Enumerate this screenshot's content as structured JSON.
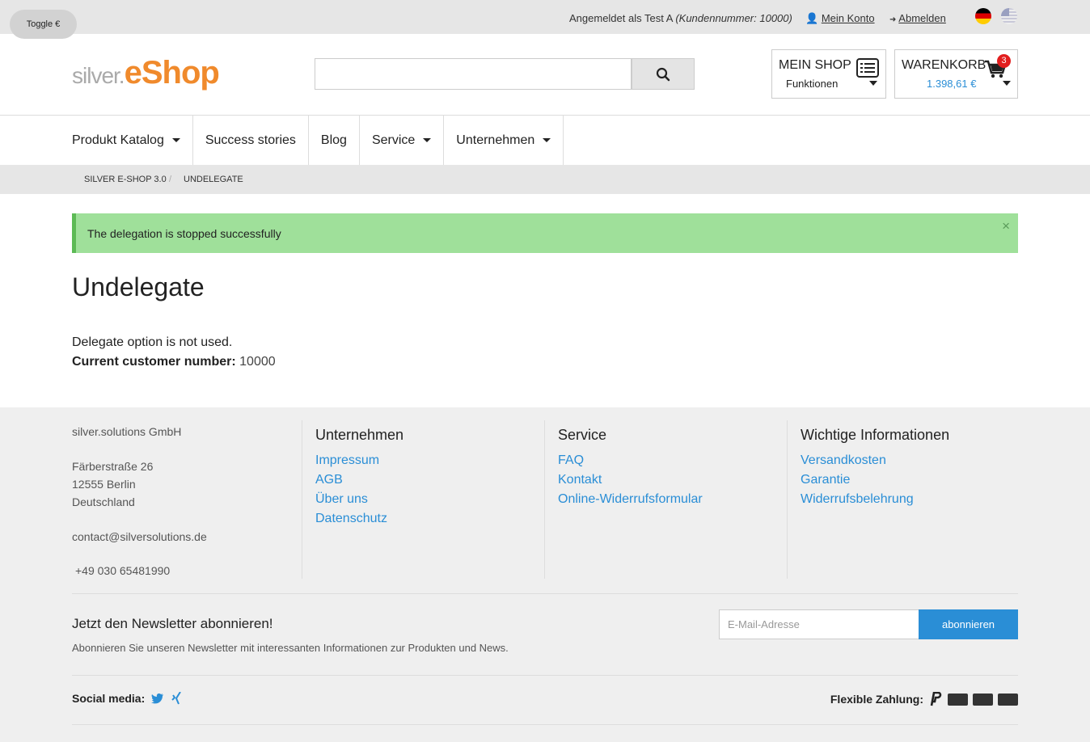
{
  "topbar": {
    "toggle_label": "Toggle €",
    "logged_in_prefix": "Angemeldet als Test A",
    "customer_number": "(Kundennummer: 10000)",
    "account_link": "Mein Konto",
    "logout_link": "Abmelden"
  },
  "logo": {
    "part1": "silver.",
    "part2": "eShop"
  },
  "search": {
    "placeholder": ""
  },
  "meinshop": {
    "title": "MEIN SHOP",
    "subtitle": "Funktionen"
  },
  "cart": {
    "title": "WARENKORB",
    "amount": "1.398,61 €",
    "count": "3"
  },
  "nav": {
    "items": [
      {
        "label": "Produkt Katalog",
        "dropdown": true
      },
      {
        "label": "Success stories",
        "dropdown": false
      },
      {
        "label": "Blog",
        "dropdown": false
      },
      {
        "label": "Service",
        "dropdown": true
      },
      {
        "label": "Unternehmen",
        "dropdown": true
      }
    ]
  },
  "breadcrumb": {
    "home": "SILVER E-SHOP 3.0",
    "separator": "/",
    "current": "UNDELEGATE"
  },
  "alert": {
    "message": "The delegation is stopped successfully",
    "close": "×"
  },
  "main": {
    "title": "Undelegate",
    "delegate_text": "Delegate option is not used.",
    "customer_label": "Current customer number:",
    "customer_value": "10000"
  },
  "footer": {
    "company": "silver.solutions GmbH",
    "street": "Färberstraße 26",
    "city": "12555 Berlin",
    "country": "Deutschland",
    "email": "contact@silversolutions.de",
    "phone": "+49 030 65481990",
    "columns": [
      {
        "heading": "Unternehmen",
        "links": [
          "Impressum",
          "AGB",
          "Über uns",
          "Datenschutz"
        ]
      },
      {
        "heading": "Service",
        "links": [
          "FAQ",
          "Kontakt",
          "Online-Widerrufsformular"
        ]
      },
      {
        "heading": "Wichtige Informationen",
        "links": [
          "Versandkosten",
          "Garantie",
          "Widerrufsbelehrung"
        ]
      }
    ],
    "newsletter_title": "Jetzt den Newsletter abonnieren!",
    "newsletter_text": "Abonnieren Sie unseren Newsletter mit interessanten Informationen zur Produkten und News.",
    "newsletter_placeholder": "E-Mail-Adresse",
    "newsletter_button": "abonnieren",
    "social_label": "Social media:",
    "payment_label": "Flexible Zahlung:"
  }
}
